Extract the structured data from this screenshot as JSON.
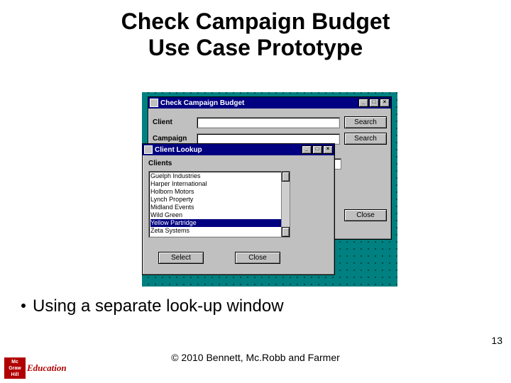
{
  "slide": {
    "title_line1": "Check Campaign Budget",
    "title_line2": "Use Case Prototype",
    "bullet": "Using a separate look-up window",
    "page_number": "13",
    "copyright": "© 2010 Bennett, Mc.Robb and Farmer"
  },
  "logo": {
    "brand_top": "Mc",
    "brand_mid": "Graw",
    "brand_bot": "Hill",
    "suffix": "Education"
  },
  "main_window": {
    "title": "Check Campaign Budget",
    "client_label": "Client",
    "campaign_label": "Campaign",
    "search_label": "Search",
    "close_label": "Close"
  },
  "lookup_window": {
    "title": "Client Lookup",
    "clients_label": "Clients",
    "select_label": "Select",
    "close_label": "Close",
    "items": [
      "Guelph Industries",
      "Harper International",
      "Holborn Motors",
      "Lynch Property",
      "Midland Events",
      "Wild Green",
      "Yellow Partridge",
      "Zeta Systems"
    ],
    "selected_index": 6
  }
}
